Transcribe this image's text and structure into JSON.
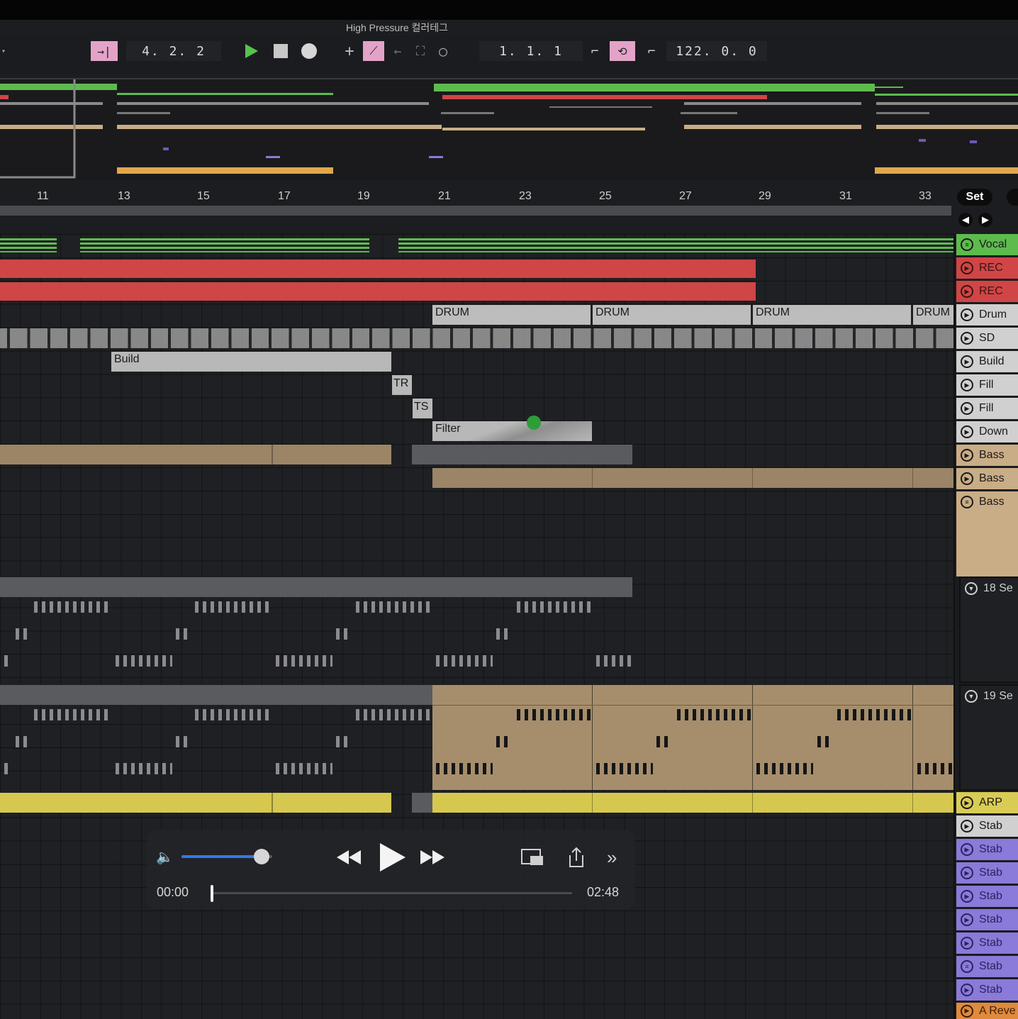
{
  "window": {
    "title": "High Pressure 컬러테그"
  },
  "transport": {
    "arrangement_position": "4.  2.  2",
    "loop_start": "1.  1.  1",
    "loop_length": "122.  0.  0"
  },
  "ruler": {
    "bars": [
      "11",
      "13",
      "15",
      "17",
      "19",
      "21",
      "23",
      "25",
      "27",
      "29",
      "31",
      "33"
    ],
    "set_label": "Set"
  },
  "clips": {
    "drum": "DRUM",
    "build": "Build",
    "tr": "TR",
    "ts": "TS",
    "filter": "Filter"
  },
  "tracks": [
    {
      "name": "Vocal",
      "color": "#5dbb4e",
      "icon": "group-icon"
    },
    {
      "name": "REC",
      "color": "#d04545",
      "icon": "play-icon"
    },
    {
      "name": "REC",
      "color": "#d04545",
      "icon": "play-icon"
    },
    {
      "name": "Drum",
      "color": "#d0d0d0",
      "icon": "play-icon"
    },
    {
      "name": "SD",
      "color": "#d0d0d0",
      "icon": "play-icon"
    },
    {
      "name": "Build",
      "color": "#d0d0d0",
      "icon": "play-icon"
    },
    {
      "name": "Fill",
      "color": "#d0d0d0",
      "icon": "play-icon"
    },
    {
      "name": "Fill",
      "color": "#d0d0d0",
      "icon": "play-icon"
    },
    {
      "name": "Down",
      "color": "#d0d0d0",
      "icon": "play-icon"
    },
    {
      "name": "Bass",
      "color": "#c9ad86",
      "icon": "play-icon"
    },
    {
      "name": "Bass",
      "color": "#c9ad86",
      "icon": "play-icon"
    },
    {
      "name": "Bass",
      "color": "#c9ad86",
      "icon": "group-icon"
    }
  ],
  "groups": [
    {
      "name": "18 Se"
    },
    {
      "name": "19 Se"
    }
  ],
  "tracks_lower": [
    {
      "name": "ARP",
      "color": "#d9cc55",
      "icon": "play-icon"
    },
    {
      "name": "Stab",
      "color": "#d0d0d0",
      "icon": "play-icon"
    },
    {
      "name": "Stab",
      "color": "#8a7ad9",
      "icon": "play-icon"
    },
    {
      "name": "Stab",
      "color": "#8a7ad9",
      "icon": "play-icon"
    },
    {
      "name": "Stab",
      "color": "#8a7ad9",
      "icon": "play-icon"
    },
    {
      "name": "Stab",
      "color": "#8a7ad9",
      "icon": "play-icon"
    },
    {
      "name": "Stab",
      "color": "#8a7ad9",
      "icon": "play-icon"
    },
    {
      "name": "Stab",
      "color": "#8a7ad9",
      "icon": "group-icon"
    },
    {
      "name": "Stab",
      "color": "#8a7ad9",
      "icon": "play-icon"
    },
    {
      "name": "A Reve",
      "color": "#e08a3c",
      "icon": "play-icon"
    }
  ],
  "player": {
    "current_time": "00:00",
    "duration": "02:48",
    "volume": 0.88,
    "progress": 0.0
  }
}
